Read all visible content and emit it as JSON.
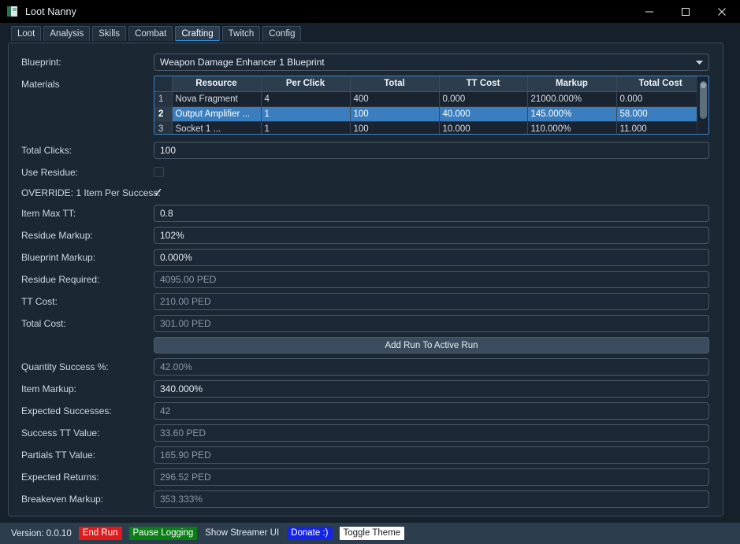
{
  "window": {
    "title": "Loot Nanny",
    "icon": "app-icon",
    "controls": {
      "minimize": "minimize-icon",
      "maximize": "maximize-icon",
      "close": "close-icon"
    }
  },
  "tabs": [
    {
      "label": "Loot",
      "active": false
    },
    {
      "label": "Analysis",
      "active": false
    },
    {
      "label": "Skills",
      "active": false
    },
    {
      "label": "Combat",
      "active": false
    },
    {
      "label": "Crafting",
      "active": true
    },
    {
      "label": "Twitch",
      "active": false
    },
    {
      "label": "Config",
      "active": false
    }
  ],
  "form": {
    "blueprint": {
      "label": "Blueprint:",
      "value": "Weapon Damage Enhancer 1 Blueprint",
      "arrow": "chevron-down-icon"
    },
    "materials_label": "Materials",
    "total_clicks": {
      "label": "Total Clicks:",
      "value": "100"
    },
    "use_residue": {
      "label": "Use Residue:",
      "checked": false
    },
    "override_one_item": {
      "label": "OVERRIDE: 1 Item Per Success:",
      "checked": true,
      "glyph": "✓"
    },
    "item_max_tt": {
      "label": "Item Max TT:",
      "value": "0.8",
      "readonly": false
    },
    "residue_markup": {
      "label": "Residue Markup:",
      "value": "102%",
      "readonly": false
    },
    "blueprint_markup": {
      "label": "Blueprint Markup:",
      "value": "0.000%",
      "readonly": false
    },
    "residue_required": {
      "label": "Residue Required:",
      "value": "4095.00 PED",
      "readonly": true
    },
    "tt_cost": {
      "label": "TT Cost:",
      "value": "210.00 PED",
      "readonly": true
    },
    "total_cost": {
      "label": "Total Cost:",
      "value": "301.00 PED",
      "readonly": true
    },
    "add_run_button": {
      "label": "Add Run To Active Run"
    },
    "quantity_success": {
      "label": "Quantity Success %:",
      "value": "42.00%",
      "readonly": true
    },
    "item_markup": {
      "label": "Item Markup:",
      "value": "340.000%",
      "readonly": false
    },
    "expected_successes": {
      "label": "Expected Successes:",
      "value": "42",
      "readonly": true
    },
    "success_tt_value": {
      "label": "Success TT Value:",
      "value": "33.60 PED",
      "readonly": true
    },
    "partials_tt_value": {
      "label": "Partials TT Value:",
      "value": "165.90 PED",
      "readonly": true
    },
    "expected_returns": {
      "label": "Expected Returns:",
      "value": "296.52 PED",
      "readonly": true
    },
    "breakeven_markup": {
      "label": "Breakeven Markup:",
      "value": "353.333%",
      "readonly": true
    }
  },
  "materials_table": {
    "columns": [
      "",
      "Resource",
      "Per Click",
      "Total",
      "TT Cost",
      "Markup",
      "Total Cost"
    ],
    "rows": [
      {
        "index": "1",
        "resource": "Nova Fragment",
        "per_click": "4",
        "total": "400",
        "tt_cost": "0.000",
        "markup": "21000.000%",
        "total_cost": "0.000",
        "selected": false
      },
      {
        "index": "2",
        "resource": "Output Amplifier ...",
        "per_click": "1",
        "total": "100",
        "tt_cost": "40.000",
        "markup": "145.000%",
        "total_cost": "58.000",
        "selected": true
      },
      {
        "index": "3",
        "resource": "Socket 1 ...",
        "per_click": "1",
        "total": "100",
        "tt_cost": "10.000",
        "markup": "110.000%",
        "total_cost": "11.000",
        "selected": false
      }
    ]
  },
  "statusbar": {
    "version": "Version: 0.0.10",
    "buttons": [
      {
        "label": "End Run",
        "bg": "#e01b1b",
        "fg": "#ffffff"
      },
      {
        "label": "Pause Logging",
        "bg": "#0a7f16",
        "fg": "#ffffff"
      },
      {
        "label": "Show Streamer UI",
        "bg": "transparent",
        "fg": "#e4eaf0"
      },
      {
        "label": "Donate :)",
        "bg": "#1425e8",
        "fg": "#ffffff"
      },
      {
        "label": "Toggle Theme",
        "bg": "#ffffff",
        "fg": "#1a1a1a"
      }
    ]
  },
  "colors": {
    "window_bg": "#1b2733",
    "panel_bg": "#16202b",
    "titlebar_bg": "#000000",
    "accent_blue": "#2f8fd8",
    "selection_blue": "#3a7ebf",
    "statusbar_bg": "#2c3d4e",
    "table_header_bg": "#2c3d4e",
    "field_border": "#4a5a69"
  }
}
